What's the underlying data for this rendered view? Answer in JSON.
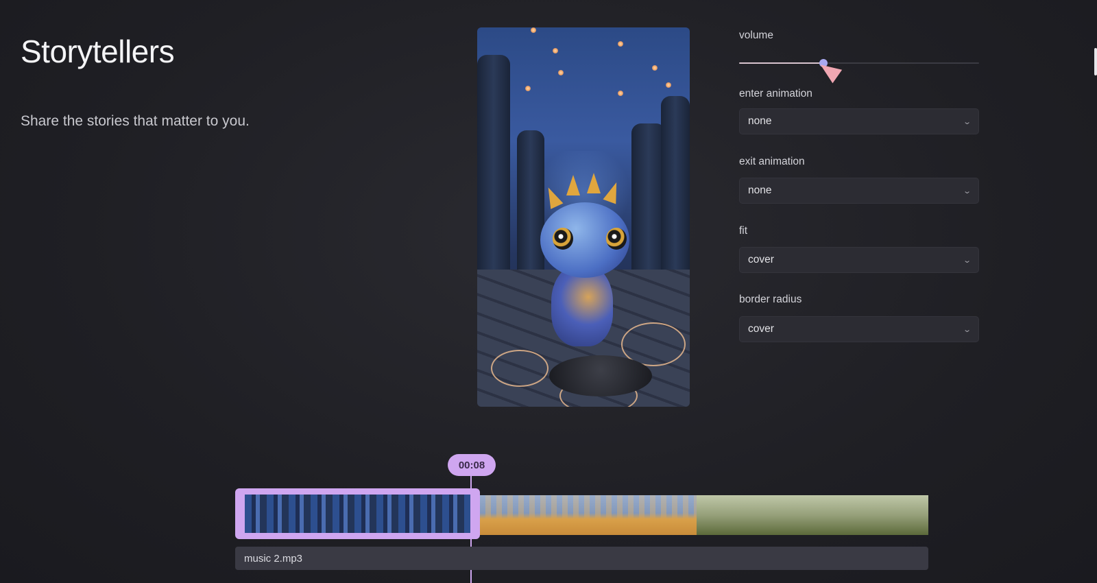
{
  "header": {
    "title": "Storytellers",
    "subtitle": "Share the stories that matter to you."
  },
  "controls": {
    "volume": {
      "label": "volume",
      "value": 0.35
    },
    "enter_animation": {
      "label": "enter animation",
      "value": "none"
    },
    "exit_animation": {
      "label": "exit animation",
      "value": "none"
    },
    "fit": {
      "label": "fit",
      "value": "cover"
    },
    "border_radius": {
      "label": "border radius",
      "value": "cover"
    }
  },
  "timeline": {
    "timecode": "00:08",
    "audio_track": "music 2.mp3"
  },
  "colors": {
    "accent": "#cfa6f0",
    "background": "#1f1f24"
  }
}
